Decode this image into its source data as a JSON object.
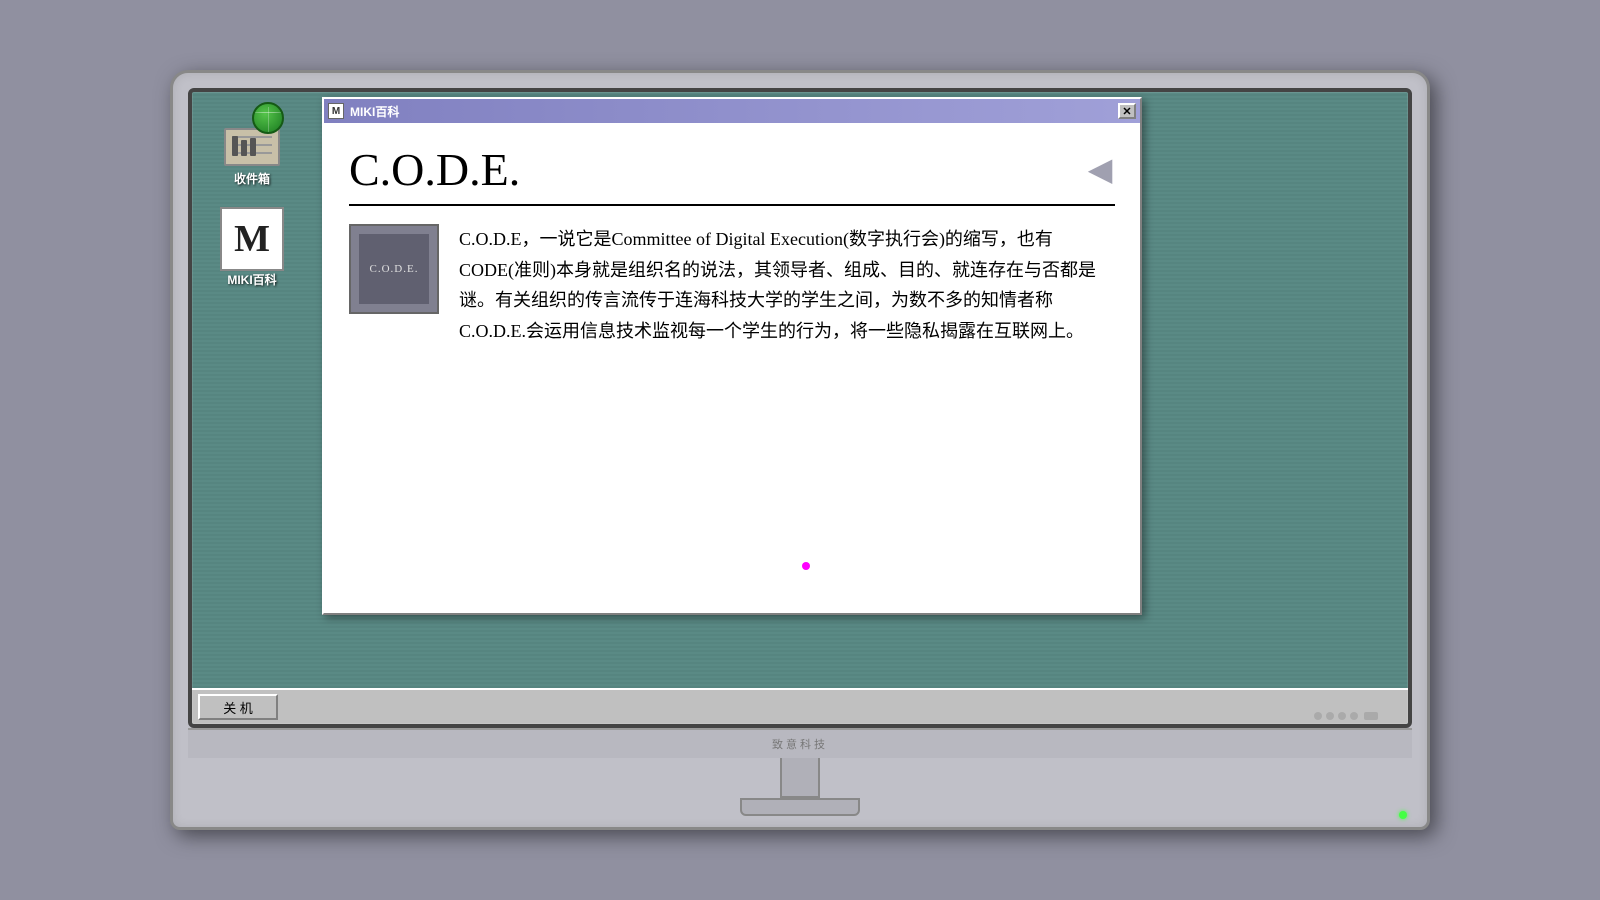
{
  "monitor": {
    "brand": "致意科技"
  },
  "taskbar": {
    "shutdown_label": "关 机"
  },
  "desktop_icons": [
    {
      "id": "inbox",
      "label": "收件箱",
      "type": "inbox"
    },
    {
      "id": "miki",
      "label": "MIKI百科",
      "type": "miki"
    }
  ],
  "window": {
    "title": "MIKI百科",
    "titlebar_icon": "M",
    "article": {
      "title": "C.O.D.E.",
      "thumbnail_text": "C.O.D.E.",
      "content": "C.O.D.E，一说它是Committee of Digital Execution(数字执行会)的缩写，也有CODE(准则)本身就是组织名的说法，其领导者、组成、目的、就连存在与否都是谜。有关组织的传言流传于连海科技大学的学生之间，为数不多的知情者称C.O.D.E.会运用信息技术监视每一个学生的行为，将一些隐私揭露在互联网上。"
    }
  }
}
